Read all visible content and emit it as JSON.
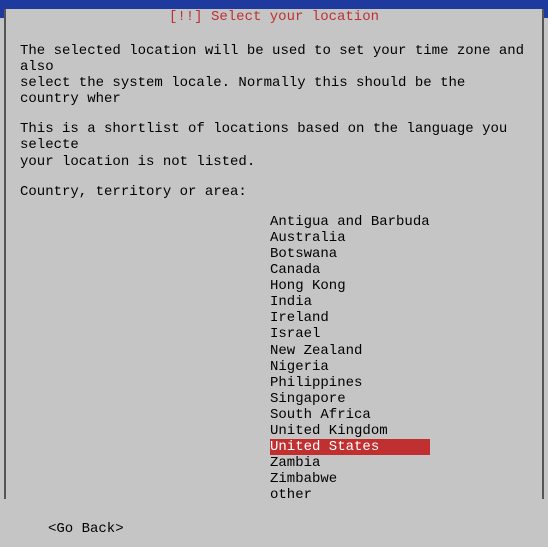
{
  "header": {
    "title": "[!!] Select your location"
  },
  "body": {
    "para1": "The selected location will be used to set your time zone and also\nselect the system locale. Normally this should be the country wher",
    "para2": "This is a shortlist of locations based on the language you selecte\nyour location is not listed.",
    "para3": "Country, territory or area:"
  },
  "locations": [
    "Antigua and Barbuda",
    "Australia",
    "Botswana",
    "Canada",
    "Hong Kong",
    "India",
    "Ireland",
    "Israel",
    "New Zealand",
    "Nigeria",
    "Philippines",
    "Singapore",
    "South Africa",
    "United Kingdom",
    "United States",
    "Zambia",
    "Zimbabwe",
    "other"
  ],
  "selected_index": 14,
  "footer": {
    "go_back": "<Go Back>"
  }
}
